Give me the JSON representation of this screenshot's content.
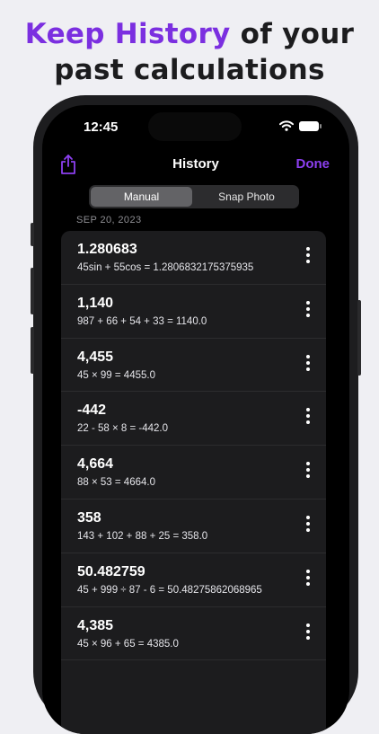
{
  "headline": {
    "accent": "Keep History",
    "rest_line1": " of your",
    "line2": "past calculations"
  },
  "status_bar": {
    "time": "12:45"
  },
  "nav": {
    "title": "History",
    "done_label": "Done"
  },
  "segments": {
    "manual": "Manual",
    "snap_photo": "Snap Photo",
    "selected": "Manual"
  },
  "section": {
    "date": "SEP 20, 2023"
  },
  "history": [
    {
      "result": "1.280683",
      "expression": "45sin + 55cos = 1.2806832175375935"
    },
    {
      "result": "1,140",
      "expression": "987 + 66 + 54 + 33 = 1140.0"
    },
    {
      "result": "4,455",
      "expression": "45 × 99 = 4455.0"
    },
    {
      "result": "-442",
      "expression": "22 - 58 × 8 = -442.0"
    },
    {
      "result": "4,664",
      "expression": "88 × 53 = 4664.0"
    },
    {
      "result": "358",
      "expression": "143 + 102 + 88 + 25 = 358.0"
    },
    {
      "result": "50.482759",
      "expression": "45 + 999 ÷ 87 - 6 = 50.48275862068965"
    },
    {
      "result": "4,385",
      "expression": "45 × 96 + 65 = 4385.0"
    }
  ],
  "colors": {
    "accent": "#7b2fe0",
    "done": "#8c3ff0",
    "background": "#efeff3",
    "card": "#1c1c1e"
  },
  "icons": {
    "share": "share-icon",
    "more": "more-vertical-icon",
    "wifi": "wifi-icon",
    "battery": "battery-icon"
  }
}
